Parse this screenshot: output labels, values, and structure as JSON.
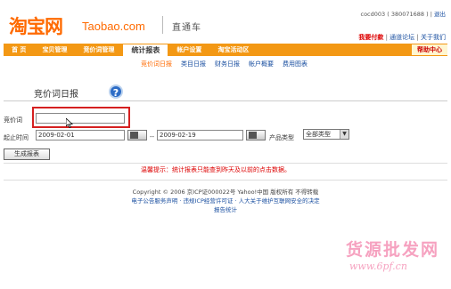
{
  "header": {
    "logo_cn": "淘宝网",
    "logo_en": "Taobao.com",
    "product": "直通车",
    "user_info": "cocd003 ( 380071688 )",
    "logout": "退出",
    "links": [
      "我要付款",
      "通道论坛",
      "关于我们"
    ]
  },
  "nav": {
    "items": [
      "首 页",
      "宝贝管理",
      "竞价词管理",
      "统计报表",
      "帐户设置",
      "淘宝活动区"
    ],
    "active": "统计报表",
    "help": "帮助中心"
  },
  "subnav": {
    "items": [
      "竞价词日报",
      "类目日报",
      "财务日报",
      "帐户概要",
      "费用图表"
    ],
    "current": "竞价词日报"
  },
  "page_title": "竞价词日报",
  "form": {
    "keyword_label": "竞价词",
    "keyword_value": "",
    "time_label": "起止时间",
    "start_date": "2009-02-01",
    "date_sep": "--",
    "end_date": "2009-02-19",
    "type_label": "产品类型",
    "type_value": "全部类型",
    "submit_label": "生成报表"
  },
  "notice": "温馨提示：统计报表只能查到昨天及以前的点击数据。",
  "footer": {
    "line1": "Copyright © 2006 京ICP证000022号 Yahoo!中国 版权所有 不得转载",
    "line2": "电子公告服务声明 · 违规ICP经营许可证 · 人大关于维护互联网安全的决定",
    "line3": "报告统计"
  },
  "watermark": {
    "text": "货源批发网",
    "url": "www.6pf.cn"
  },
  "colors": {
    "nav_orange": "#f39814",
    "logo_orange": "#ff6a00",
    "highlight_red": "#d52020",
    "link_blue": "#1a4fa0"
  }
}
